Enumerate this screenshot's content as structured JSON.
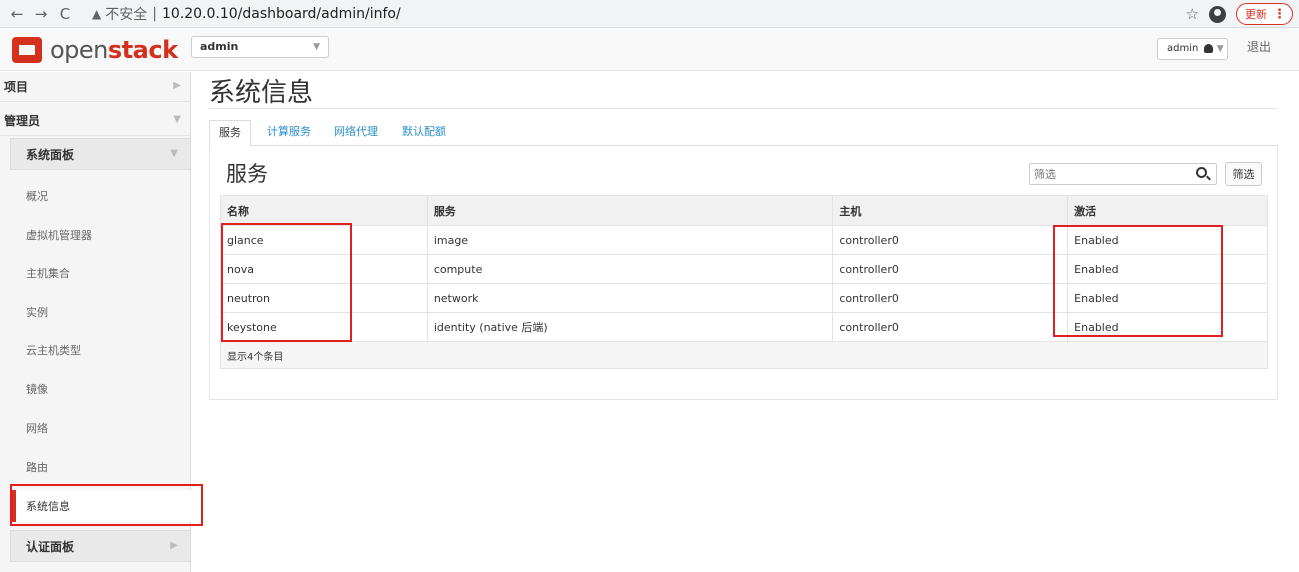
{
  "browser": {
    "url_warning": "不安全",
    "url": "10.20.0.10/dashboard/admin/info/",
    "update_label": "更新"
  },
  "header": {
    "logo_open": "open",
    "logo_stack": "stack",
    "project": "admin",
    "user": "admin",
    "logout": "退出"
  },
  "sidebar": {
    "project": "项目",
    "admin": "管理员",
    "system_panel": "系统面板",
    "items": [
      "概况",
      "虚拟机管理器",
      "主机集合",
      "实例",
      "云主机类型",
      "镜像",
      "网络",
      "路由"
    ],
    "active_item": "系统信息",
    "identity_panel": "认证面板"
  },
  "main": {
    "title": "系统信息",
    "tabs": [
      "服务",
      "计算服务",
      "网络代理",
      "默认配额"
    ],
    "section_title": "服务",
    "filter_placeholder": "筛选",
    "filter_button": "筛选",
    "table": {
      "headers": [
        "名称",
        "服务",
        "主机",
        "激活"
      ],
      "rows": [
        [
          "glance",
          "image",
          "controller0",
          "Enabled"
        ],
        [
          "nova",
          "compute",
          "controller0",
          "Enabled"
        ],
        [
          "neutron",
          "network",
          "controller0",
          "Enabled"
        ],
        [
          "keystone",
          "identity (native 后端)",
          "controller0",
          "Enabled"
        ]
      ],
      "footer": "显示4个条目"
    }
  },
  "colors": {
    "brand": "#d3301e",
    "link": "#2b8fc9",
    "highlight": "#e02020"
  }
}
